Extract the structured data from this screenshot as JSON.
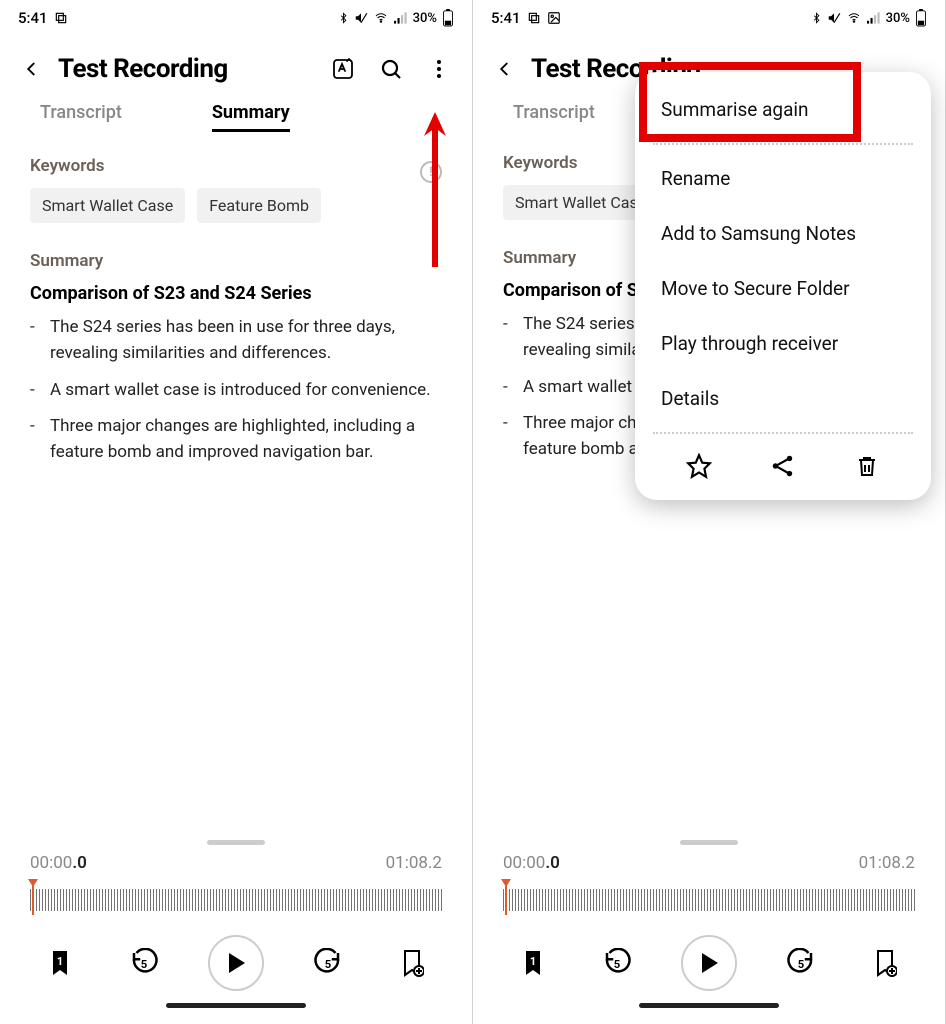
{
  "status": {
    "time": "5:41",
    "battery_pct": "30%"
  },
  "header": {
    "title": "Test Recording",
    "tabs": {
      "transcript": "Transcript",
      "summary": "Summary",
      "active": "summary"
    }
  },
  "content": {
    "keywords_label": "Keywords",
    "keywords": [
      "Smart Wallet Case",
      "Feature Bomb"
    ],
    "summary_label": "Summary",
    "summary_title": "Comparison of S23 and S24 Series",
    "bullets": [
      "The S24 series has been in use for three days, revealing similarities and differences.",
      "A smart wallet case is introduced for convenience.",
      "Three major changes are highlighted, including a feature bomb and improved navigation bar."
    ]
  },
  "player": {
    "current_time": "00:00",
    "current_dec": ".0",
    "total_time": "01:08",
    "total_dec": ".2",
    "bookmark_count": "1"
  },
  "menu": {
    "items": [
      "Summarise again",
      "Rename",
      "Add to Samsung Notes",
      "Move to Secure Folder",
      "Play through receiver",
      "Details"
    ]
  },
  "annotation": {
    "arrow_color": "#e30000",
    "highlight_color": "#e30000"
  }
}
